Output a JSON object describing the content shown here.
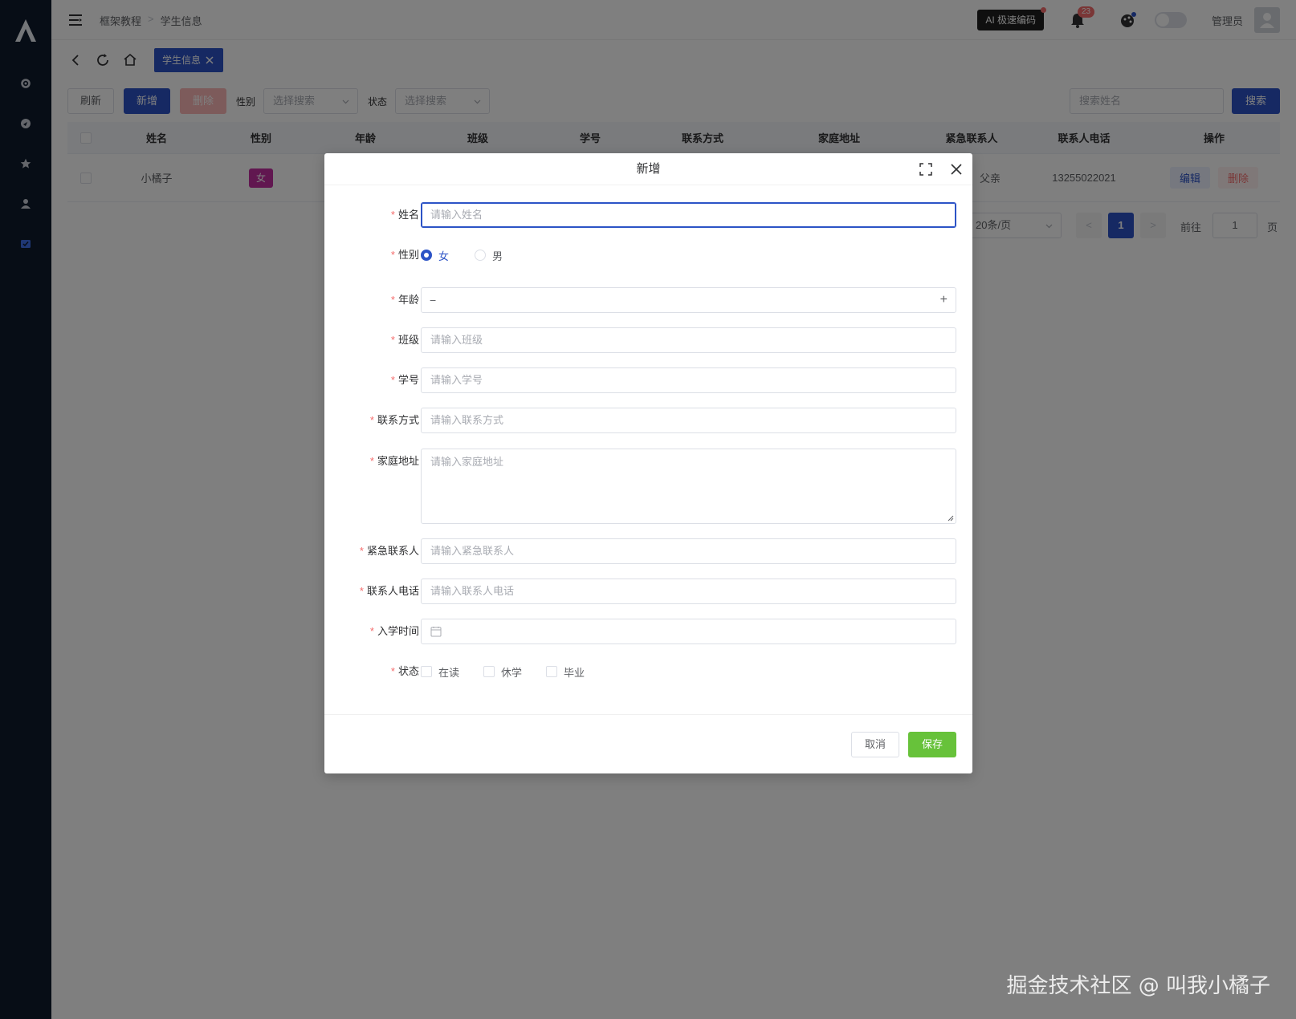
{
  "header": {
    "breadcrumb": [
      "框架教程",
      "学生信息"
    ],
    "ai_button": "AI 极速编码",
    "notification_count": "23",
    "user_name": "管理员"
  },
  "tabs": {
    "active": "学生信息"
  },
  "toolbar": {
    "refresh": "刷新",
    "add": "新增",
    "delete": "删除",
    "gender_label": "性别",
    "gender_placeholder": "选择搜索",
    "status_label": "状态",
    "status_placeholder": "选择搜索",
    "search_placeholder": "搜索姓名",
    "search_button": "搜索"
  },
  "table": {
    "columns": [
      "姓名",
      "性别",
      "年龄",
      "班级",
      "学号",
      "联系方式",
      "家庭地址",
      "紧急联系人",
      "联系人电话",
      "操作"
    ],
    "rows": [
      {
        "name": "小橘子",
        "gender": "女",
        "contact_tail": "父亲",
        "phone": "13255022021",
        "edit": "编辑",
        "delete": "删除"
      }
    ]
  },
  "pagination": {
    "page_size": "20条/页",
    "current_page": "1",
    "goto_label": "前往",
    "goto_value": "1",
    "page_unit": "页"
  },
  "dialog": {
    "title": "新增",
    "fields": {
      "name": {
        "label": "姓名",
        "placeholder": "请输入姓名"
      },
      "gender": {
        "label": "性别",
        "options": [
          "女",
          "男"
        ],
        "selected": "女"
      },
      "age": {
        "label": "年龄",
        "minus": "−",
        "plus": "+"
      },
      "class": {
        "label": "班级",
        "placeholder": "请输入班级"
      },
      "student_id": {
        "label": "学号",
        "placeholder": "请输入学号"
      },
      "contact": {
        "label": "联系方式",
        "placeholder": "请输入联系方式"
      },
      "address": {
        "label": "家庭地址",
        "placeholder": "请输入家庭地址"
      },
      "emergency_contact": {
        "label": "紧急联系人",
        "placeholder": "请输入紧急联系人"
      },
      "emergency_phone": {
        "label": "联系人电话",
        "placeholder": "请输入联系人电话"
      },
      "enroll_date": {
        "label": "入学时间"
      },
      "status": {
        "label": "状态",
        "options": [
          "在读",
          "休学",
          "毕业"
        ]
      }
    },
    "cancel": "取消",
    "save": "保存"
  },
  "watermark": "掘金技术社区 @ 叫我小橘子",
  "colors": {
    "primary": "#2c53c6",
    "success": "#67c23a",
    "danger": "#f56c6c",
    "sidebar": "#0f1a2c",
    "tag_female": "#c22fa0"
  }
}
